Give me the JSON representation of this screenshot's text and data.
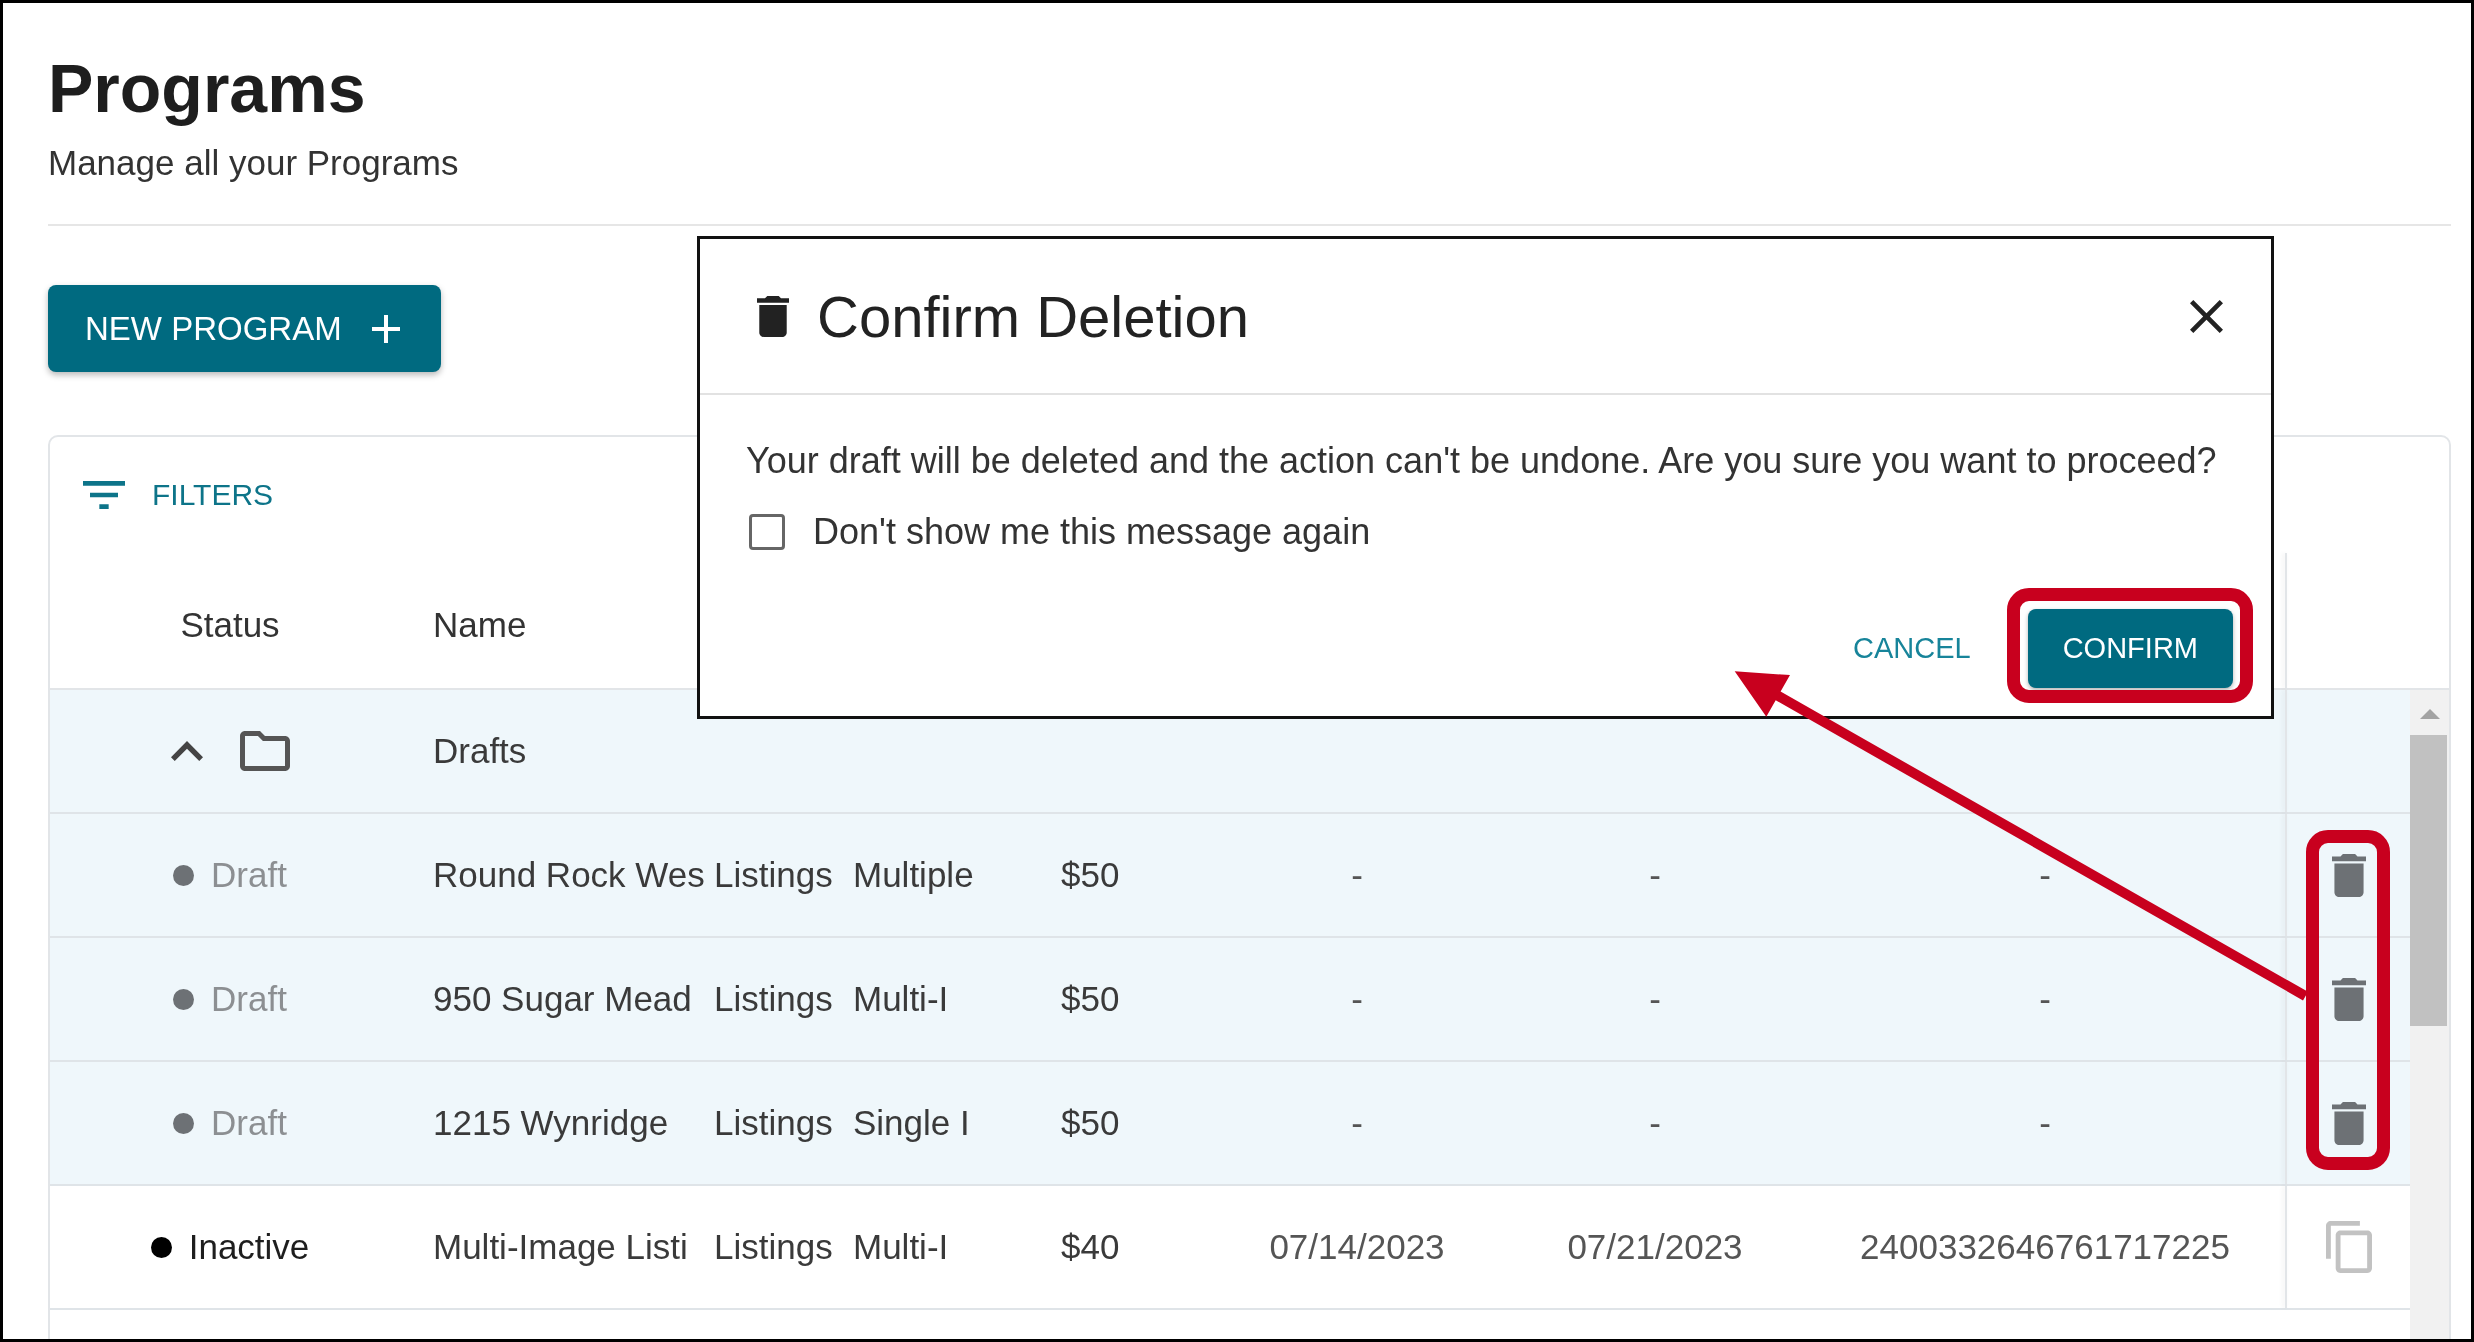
{
  "page": {
    "title": "Programs",
    "subtitle": "Manage all your Programs"
  },
  "new_program_button": {
    "label": "NEW PROGRAM"
  },
  "filters": {
    "label": "FILTERS"
  },
  "table": {
    "columns": [
      "Status",
      "Name"
    ],
    "rows": [
      {
        "kind": "group",
        "label": "Drafts",
        "expanded": true,
        "children": [
          {
            "kind": "draft",
            "status": "Draft",
            "color": "#6d7175",
            "name": "Round Rock Wes",
            "column_3": "Listings",
            "column_4": "Multiple",
            "column_5": "$50",
            "column_6": "-",
            "column_7": "-",
            "column_8": "-",
            "highlighted": true
          },
          {
            "kind": "draft",
            "status": "Draft",
            "color": "#6d7175",
            "name": "950 Sugar Mead",
            "column_3": "Listings",
            "column_4": "Multi-I",
            "column_5": "$50",
            "column_6": "-",
            "column_7": "-",
            "column_8": "-",
            "highlighted": true
          },
          {
            "kind": "draft",
            "status": "Draft",
            "color": "#6d7175",
            "name": "1215 Wynridge",
            "column_3": "Listings",
            "column_4": "Single I",
            "column_5": "$50",
            "column_6": "-",
            "column_7": "-",
            "column_8": "-",
            "highlighted": true
          }
        ]
      },
      {
        "kind": "program",
        "status": "Inactive",
        "color": "#000000",
        "name": "Multi-Image Listi",
        "column_3": "Listings",
        "column_4": "Multi-I",
        "column_5": "$40",
        "column_6": "07/14/2023",
        "column_7": "07/21/2023",
        "column_8": "2400332646761717225",
        "highlighted": false
      }
    ]
  },
  "dialog": {
    "title": "Confirm Deletion",
    "message": "Your draft will be deleted and the action can't be undone. Are you sure you want to proceed?",
    "checkbox": {
      "label": "Don't show me this message again",
      "checked": false
    },
    "buttons": [
      {
        "label": "CANCEL",
        "kind": "text",
        "highlighted": false
      },
      {
        "label": "CONFIRM",
        "kind": "primary",
        "highlighted": true
      }
    ]
  }
}
